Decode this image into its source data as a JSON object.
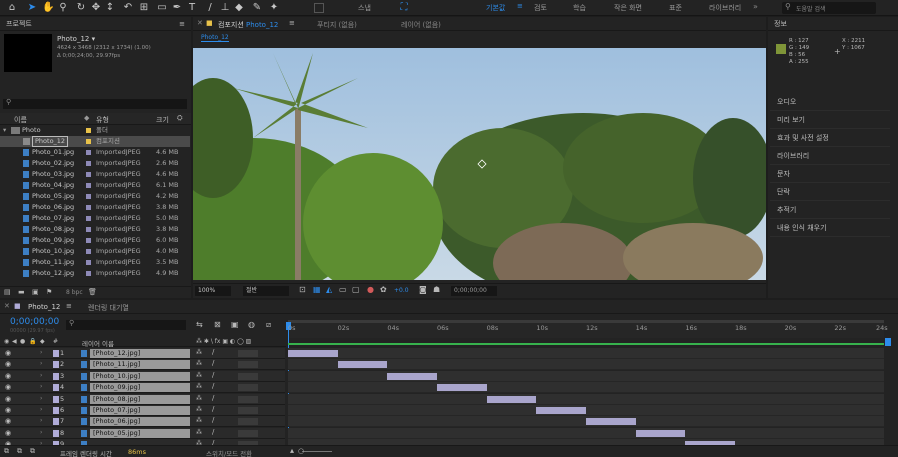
{
  "toolbar": {
    "workspaces": [
      {
        "label": "기본값",
        "active": true
      },
      {
        "label": "검토",
        "active": false
      },
      {
        "label": "학습",
        "active": false
      },
      {
        "label": "작은 화면",
        "active": false
      },
      {
        "label": "표준",
        "active": false
      },
      {
        "label": "라이브러리",
        "active": false
      }
    ],
    "search_placeholder": "도움말 검색",
    "snap_label": "스냅"
  },
  "project": {
    "title": "프로젝트",
    "selected_name": "Photo_12 ▾",
    "selected_dims": "4624 x 3468 (2312 x 1734) (1.00)",
    "selected_dur": "Δ 0;00;24;00, 29.97fps",
    "col_name": "이름",
    "col_type": "유형",
    "col_size": "크기",
    "bpc": "8 bpc",
    "items": [
      {
        "name": "Photo",
        "type": "폴더",
        "size": "",
        "kind": "folder",
        "label_color": "#e8c24a"
      },
      {
        "name": "Photo_12",
        "type": "컴포지션",
        "size": "",
        "kind": "comp",
        "label_color": "#e8c24a"
      },
      {
        "name": "Photo_01.jpg",
        "type": "ImportedJPEG",
        "size": "4.6 MB",
        "kind": "file"
      },
      {
        "name": "Photo_02.jpg",
        "type": "ImportedJPEG",
        "size": "2.6 MB",
        "kind": "file"
      },
      {
        "name": "Photo_03.jpg",
        "type": "ImportedJPEG",
        "size": "4.6 MB",
        "kind": "file"
      },
      {
        "name": "Photo_04.jpg",
        "type": "ImportedJPEG",
        "size": "6.1 MB",
        "kind": "file"
      },
      {
        "name": "Photo_05.jpg",
        "type": "ImportedJPEG",
        "size": "4.2 MB",
        "kind": "file"
      },
      {
        "name": "Photo_06.jpg",
        "type": "ImportedJPEG",
        "size": "3.8 MB",
        "kind": "file"
      },
      {
        "name": "Photo_07.jpg",
        "type": "ImportedJPEG",
        "size": "5.0 MB",
        "kind": "file"
      },
      {
        "name": "Photo_08.jpg",
        "type": "ImportedJPEG",
        "size": "3.8 MB",
        "kind": "file"
      },
      {
        "name": "Photo_09.jpg",
        "type": "ImportedJPEG",
        "size": "6.0 MB",
        "kind": "file"
      },
      {
        "name": "Photo_10.jpg",
        "type": "ImportedJPEG",
        "size": "4.0 MB",
        "kind": "file"
      },
      {
        "name": "Photo_11.jpg",
        "type": "ImportedJPEG",
        "size": "3.5 MB",
        "kind": "file"
      },
      {
        "name": "Photo_12.jpg",
        "type": "ImportedJPEG",
        "size": "4.9 MB",
        "kind": "file"
      }
    ]
  },
  "viewer": {
    "tab_comp": "컴포지션",
    "tab_comp_name": "Photo_12",
    "tab_footage": "푸티지 (없음)",
    "tab_layer": "레이어 (없음)",
    "breadcrumb": "Photo_12",
    "zoom": "100%",
    "resolution": "절반",
    "exposure": "+0.0",
    "timecode": "0;00;00;00"
  },
  "info": {
    "title": "정보",
    "color_swatch": "#7f9538",
    "r": "R :  127",
    "g": "G :  149",
    "b": "B :  56",
    "a": "A :  255",
    "x": "X :  2211",
    "y": "Y :  1067",
    "panels": [
      "오디오",
      "미리 보기",
      "효과 및 사전 설정",
      "라이브러리",
      "문자",
      "단락",
      "추적기",
      "내용 인식 채우기"
    ]
  },
  "timeline": {
    "comp_tab": "Photo_12",
    "render_queue_tab": "렌더링 대기열",
    "timecode": "0;00;00;00",
    "timecode_sub": "00000 (29.97 fps)",
    "col_layer_name": "레이어 이름",
    "render_time_label": "프레임 렌더링 시간",
    "render_time_value": "86ms",
    "toggle_switches": "스위치/모드 전환",
    "ruler": [
      "0s",
      "02s",
      "04s",
      "06s",
      "08s",
      "10s",
      "12s",
      "14s",
      "16s",
      "18s",
      "20s",
      "22s",
      "24s"
    ],
    "layers": [
      {
        "num": "1",
        "name": "[Photo_12.jpg]",
        "start": 0,
        "end": 2
      },
      {
        "num": "2",
        "name": "[Photo_11.jpg]",
        "start": 2,
        "end": 4
      },
      {
        "num": "3",
        "name": "[Photo_10.jpg]",
        "start": 4,
        "end": 6
      },
      {
        "num": "4",
        "name": "[Photo_09.jpg]",
        "start": 6,
        "end": 8
      },
      {
        "num": "5",
        "name": "[Photo_08.jpg]",
        "start": 8,
        "end": 10
      },
      {
        "num": "6",
        "name": "[Photo_07.jpg]",
        "start": 10,
        "end": 12
      },
      {
        "num": "7",
        "name": "[Photo_06.jpg]",
        "start": 12,
        "end": 14
      },
      {
        "num": "8",
        "name": "[Photo_05.jpg]",
        "start": 14,
        "end": 16
      },
      {
        "num": "9",
        "name": "",
        "start": 16,
        "end": 18
      }
    ]
  }
}
